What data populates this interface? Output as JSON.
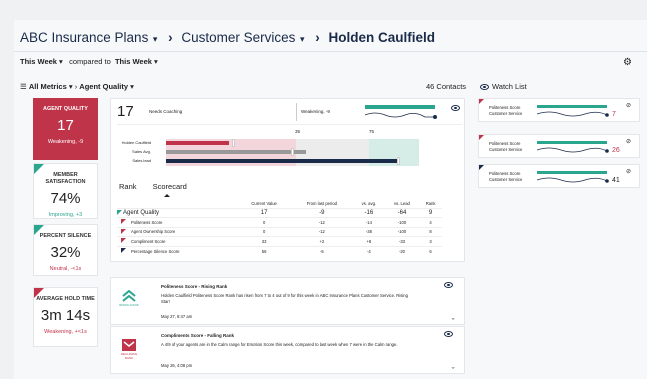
{
  "breadcrumb": {
    "plan": "ABC Insurance Plans",
    "service": "Customer Services",
    "agent": "Holden Caulfield"
  },
  "filters": {
    "period": "This Week",
    "compared": "compared to",
    "comparePeriod": "This Week"
  },
  "metricsBar": {
    "allMetrics": "All Metrics",
    "quality": "Agent Quality",
    "contacts": "46 Contacts",
    "watchList": "Watch List"
  },
  "cards": [
    {
      "label": "AGENT QUALITY",
      "value": "17",
      "sub": "Weakening, -9"
    },
    {
      "label": "MEMBER SATISFACTION",
      "value": "74%",
      "sub": "Improving, +3"
    },
    {
      "label": "PERCENT SILENCE",
      "value": "32%",
      "sub": "Neutral, -<1s"
    },
    {
      "label": "AVERAGE HOLD TIME",
      "value": "3m 14s",
      "sub": "Weakening, +<1s"
    }
  ],
  "main": {
    "score": "17",
    "needs": "Needs Coaching",
    "weak": "Weakening, -9",
    "tick1": "35",
    "tick2": "75",
    "bars": [
      "Holden Caulfield",
      "Sales Avg.",
      "Sales lead"
    ],
    "tabs": [
      "Rank",
      "Scorecard"
    ]
  },
  "table": {
    "headers": [
      "",
      "Current Value",
      "From last period",
      "vs. avg.",
      "vs. Lead",
      "Rank"
    ],
    "rows": [
      [
        "Agent Quality",
        "17",
        "-9",
        "-16",
        "-64",
        "9"
      ],
      [
        "Politeness Score",
        "0",
        "-12",
        "-14",
        "-100",
        "4"
      ],
      [
        "Agent Ownership Score",
        "0",
        "-12",
        "-38",
        "-100",
        "8"
      ],
      [
        "Compliment Score",
        "33",
        "+2",
        "+8",
        "-33",
        "3"
      ],
      [
        "Percentage Silence Score",
        "56",
        "-5",
        "-4",
        "-20",
        "6"
      ]
    ]
  },
  "feed": [
    {
      "title": "Politeness Score - Rising Rank",
      "text": "Holden Caulfield Politeness Score Rank has risen from 7 to 4 out of 9 for this week in ABC Insurance Plans Customer Service. Rising Star!",
      "date": "May 27, 8:47 am",
      "icon": "RISING RANK"
    },
    {
      "title": "Compliments Score - Falling Rank",
      "text": "A 4/9 of your agents are in the Calm range for Emotion Score this week, compared to last week when 7 were in the Calm range.",
      "date": "May 26, 4:08 pm",
      "icon": "DECLINING RANK"
    }
  ],
  "watch": [
    {
      "l1": "Politeness Score",
      "l2": "Customer Service",
      "num": "7",
      "color": "#c0344a"
    },
    {
      "l1": "Politeness Score",
      "l2": "Customer Service",
      "num": "26",
      "color": "#c0344a"
    },
    {
      "l1": "Politeness Score",
      "l2": "Customer Service",
      "num": "41",
      "color": "#1a2b4a"
    }
  ]
}
